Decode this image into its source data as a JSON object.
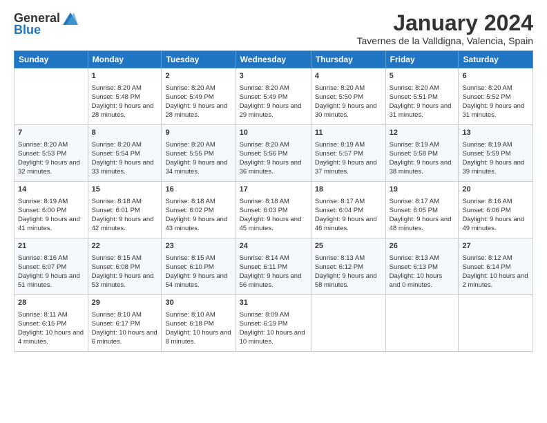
{
  "logo": {
    "general": "General",
    "blue": "Blue"
  },
  "title": "January 2024",
  "subtitle": "Tavernes de la Valldigna, Valencia, Spain",
  "weekdays": [
    "Sunday",
    "Monday",
    "Tuesday",
    "Wednesday",
    "Thursday",
    "Friday",
    "Saturday"
  ],
  "weeks": [
    [
      {
        "day": "",
        "sunrise": "",
        "sunset": "",
        "daylight": ""
      },
      {
        "day": "1",
        "sunrise": "Sunrise: 8:20 AM",
        "sunset": "Sunset: 5:48 PM",
        "daylight": "Daylight: 9 hours and 28 minutes."
      },
      {
        "day": "2",
        "sunrise": "Sunrise: 8:20 AM",
        "sunset": "Sunset: 5:49 PM",
        "daylight": "Daylight: 9 hours and 28 minutes."
      },
      {
        "day": "3",
        "sunrise": "Sunrise: 8:20 AM",
        "sunset": "Sunset: 5:49 PM",
        "daylight": "Daylight: 9 hours and 29 minutes."
      },
      {
        "day": "4",
        "sunrise": "Sunrise: 8:20 AM",
        "sunset": "Sunset: 5:50 PM",
        "daylight": "Daylight: 9 hours and 30 minutes."
      },
      {
        "day": "5",
        "sunrise": "Sunrise: 8:20 AM",
        "sunset": "Sunset: 5:51 PM",
        "daylight": "Daylight: 9 hours and 31 minutes."
      },
      {
        "day": "6",
        "sunrise": "Sunrise: 8:20 AM",
        "sunset": "Sunset: 5:52 PM",
        "daylight": "Daylight: 9 hours and 31 minutes."
      }
    ],
    [
      {
        "day": "7",
        "sunrise": "Sunrise: 8:20 AM",
        "sunset": "Sunset: 5:53 PM",
        "daylight": "Daylight: 9 hours and 32 minutes."
      },
      {
        "day": "8",
        "sunrise": "Sunrise: 8:20 AM",
        "sunset": "Sunset: 5:54 PM",
        "daylight": "Daylight: 9 hours and 33 minutes."
      },
      {
        "day": "9",
        "sunrise": "Sunrise: 8:20 AM",
        "sunset": "Sunset: 5:55 PM",
        "daylight": "Daylight: 9 hours and 34 minutes."
      },
      {
        "day": "10",
        "sunrise": "Sunrise: 8:20 AM",
        "sunset": "Sunset: 5:56 PM",
        "daylight": "Daylight: 9 hours and 36 minutes."
      },
      {
        "day": "11",
        "sunrise": "Sunrise: 8:19 AM",
        "sunset": "Sunset: 5:57 PM",
        "daylight": "Daylight: 9 hours and 37 minutes."
      },
      {
        "day": "12",
        "sunrise": "Sunrise: 8:19 AM",
        "sunset": "Sunset: 5:58 PM",
        "daylight": "Daylight: 9 hours and 38 minutes."
      },
      {
        "day": "13",
        "sunrise": "Sunrise: 8:19 AM",
        "sunset": "Sunset: 5:59 PM",
        "daylight": "Daylight: 9 hours and 39 minutes."
      }
    ],
    [
      {
        "day": "14",
        "sunrise": "Sunrise: 8:19 AM",
        "sunset": "Sunset: 6:00 PM",
        "daylight": "Daylight: 9 hours and 41 minutes."
      },
      {
        "day": "15",
        "sunrise": "Sunrise: 8:18 AM",
        "sunset": "Sunset: 6:01 PM",
        "daylight": "Daylight: 9 hours and 42 minutes."
      },
      {
        "day": "16",
        "sunrise": "Sunrise: 8:18 AM",
        "sunset": "Sunset: 6:02 PM",
        "daylight": "Daylight: 9 hours and 43 minutes."
      },
      {
        "day": "17",
        "sunrise": "Sunrise: 8:18 AM",
        "sunset": "Sunset: 6:03 PM",
        "daylight": "Daylight: 9 hours and 45 minutes."
      },
      {
        "day": "18",
        "sunrise": "Sunrise: 8:17 AM",
        "sunset": "Sunset: 6:04 PM",
        "daylight": "Daylight: 9 hours and 46 minutes."
      },
      {
        "day": "19",
        "sunrise": "Sunrise: 8:17 AM",
        "sunset": "Sunset: 6:05 PM",
        "daylight": "Daylight: 9 hours and 48 minutes."
      },
      {
        "day": "20",
        "sunrise": "Sunrise: 8:16 AM",
        "sunset": "Sunset: 6:06 PM",
        "daylight": "Daylight: 9 hours and 49 minutes."
      }
    ],
    [
      {
        "day": "21",
        "sunrise": "Sunrise: 8:16 AM",
        "sunset": "Sunset: 6:07 PM",
        "daylight": "Daylight: 9 hours and 51 minutes."
      },
      {
        "day": "22",
        "sunrise": "Sunrise: 8:15 AM",
        "sunset": "Sunset: 6:08 PM",
        "daylight": "Daylight: 9 hours and 53 minutes."
      },
      {
        "day": "23",
        "sunrise": "Sunrise: 8:15 AM",
        "sunset": "Sunset: 6:10 PM",
        "daylight": "Daylight: 9 hours and 54 minutes."
      },
      {
        "day": "24",
        "sunrise": "Sunrise: 8:14 AM",
        "sunset": "Sunset: 6:11 PM",
        "daylight": "Daylight: 9 hours and 56 minutes."
      },
      {
        "day": "25",
        "sunrise": "Sunrise: 8:13 AM",
        "sunset": "Sunset: 6:12 PM",
        "daylight": "Daylight: 9 hours and 58 minutes."
      },
      {
        "day": "26",
        "sunrise": "Sunrise: 8:13 AM",
        "sunset": "Sunset: 6:13 PM",
        "daylight": "Daylight: 10 hours and 0 minutes."
      },
      {
        "day": "27",
        "sunrise": "Sunrise: 8:12 AM",
        "sunset": "Sunset: 6:14 PM",
        "daylight": "Daylight: 10 hours and 2 minutes."
      }
    ],
    [
      {
        "day": "28",
        "sunrise": "Sunrise: 8:11 AM",
        "sunset": "Sunset: 6:15 PM",
        "daylight": "Daylight: 10 hours and 4 minutes."
      },
      {
        "day": "29",
        "sunrise": "Sunrise: 8:10 AM",
        "sunset": "Sunset: 6:17 PM",
        "daylight": "Daylight: 10 hours and 6 minutes."
      },
      {
        "day": "30",
        "sunrise": "Sunrise: 8:10 AM",
        "sunset": "Sunset: 6:18 PM",
        "daylight": "Daylight: 10 hours and 8 minutes."
      },
      {
        "day": "31",
        "sunrise": "Sunrise: 8:09 AM",
        "sunset": "Sunset: 6:19 PM",
        "daylight": "Daylight: 10 hours and 10 minutes."
      },
      {
        "day": "",
        "sunrise": "",
        "sunset": "",
        "daylight": ""
      },
      {
        "day": "",
        "sunrise": "",
        "sunset": "",
        "daylight": ""
      },
      {
        "day": "",
        "sunrise": "",
        "sunset": "",
        "daylight": ""
      }
    ]
  ]
}
